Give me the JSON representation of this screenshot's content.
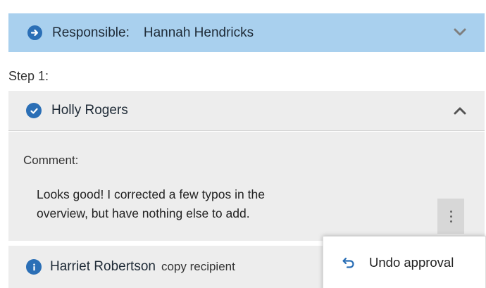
{
  "responsible": {
    "label": "Responsible:",
    "name": "Hannah Hendricks",
    "icon": "arrow-right-circle-icon",
    "expand_icon": "chevron-down-icon"
  },
  "step": {
    "label": "Step 1:"
  },
  "approver": {
    "name": "Holly Rogers",
    "icon": "check-circle-icon",
    "collapse_icon": "chevron-up-icon",
    "comment_label": "Comment:",
    "comment_line1": "Looks good! I corrected a few typos in the",
    "comment_line2": "overview, but have nothing else to add.",
    "more_icon": "vertical-ellipsis-icon"
  },
  "copy_recipient": {
    "name": "Harriet Robertson",
    "role": "copy recipient",
    "icon": "info-circle-icon"
  },
  "context_menu": {
    "items": [
      {
        "label": "Undo approval",
        "icon": "undo-icon"
      }
    ]
  },
  "colors": {
    "accent": "#2b6fb6",
    "header_bg": "#a9d0ee",
    "panel_bg": "#ededed"
  }
}
